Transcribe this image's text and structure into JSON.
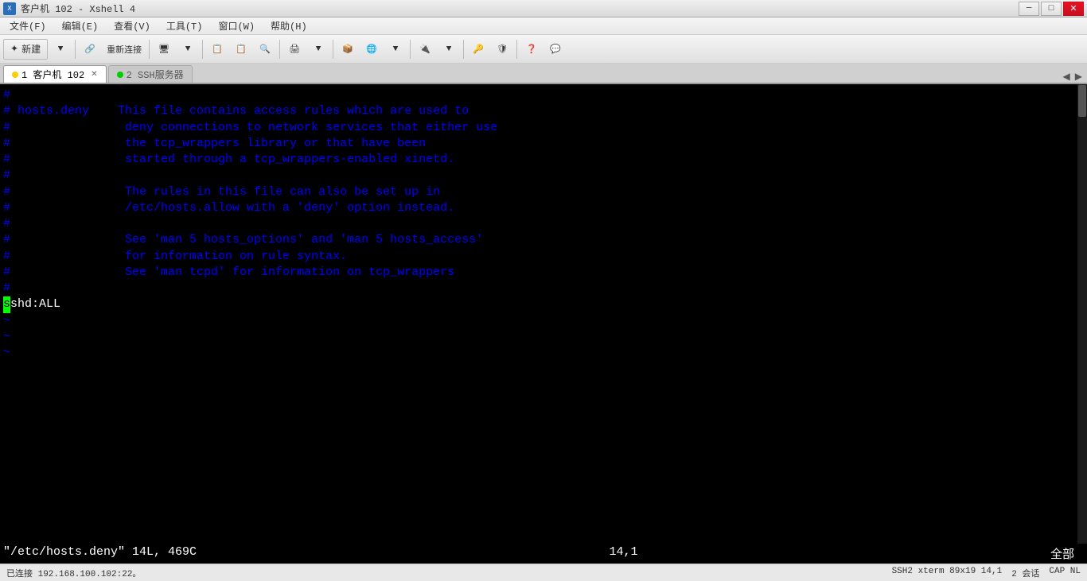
{
  "titlebar": {
    "title": "客户机 102 - Xshell 4",
    "icon": "X",
    "minimize": "─",
    "maximize": "□",
    "close": "✕"
  },
  "menubar": {
    "items": [
      "文件(F)",
      "编辑(E)",
      "查看(V)",
      "工具(T)",
      "窗口(W)",
      "帮助(H)"
    ]
  },
  "toolbar": {
    "new_label": "新建",
    "reconnect_label": "重新连接",
    "buttons": [
      "📁",
      "◀",
      "🔗",
      "🔄",
      "📋",
      "📋",
      "🔍",
      "🖨️",
      "◀",
      "📦",
      "🌐",
      "◀",
      "🔌",
      "◀",
      "🔑",
      "🛡️",
      "❓",
      "💬"
    ]
  },
  "tabs": [
    {
      "id": "tab1",
      "label": "1 客户机 102",
      "active": true,
      "dot_color": "#ffcc00"
    },
    {
      "id": "tab2",
      "label": "2 SSH服务器",
      "active": false,
      "dot_color": "#00cc00"
    }
  ],
  "terminal": {
    "lines": [
      {
        "type": "hash",
        "content": "#"
      },
      {
        "type": "hash",
        "content": "# hosts.deny    This file contains access rules which are used to"
      },
      {
        "type": "hash",
        "content": "#                deny connections to network services that either use"
      },
      {
        "type": "hash",
        "content": "#                the tcp_wrappers library or that have been"
      },
      {
        "type": "hash",
        "content": "#                started through a tcp_wrappers-enabled xinetd."
      },
      {
        "type": "hash",
        "content": "#"
      },
      {
        "type": "hash",
        "content": "#                The rules in this file can also be set up in"
      },
      {
        "type": "hash",
        "content": "#                /etc/hosts.allow with a 'deny' option instead."
      },
      {
        "type": "hash",
        "content": "#"
      },
      {
        "type": "hash",
        "content": "#                See 'man 5 hosts_options' and 'man 5 hosts_access'"
      },
      {
        "type": "hash",
        "content": "#                for information on rule syntax."
      },
      {
        "type": "hash",
        "content": "#                See 'man tcpd' for information on tcp_wrappers"
      },
      {
        "type": "hash",
        "content": "#"
      },
      {
        "type": "cursor",
        "content": "sshd:ALL"
      },
      {
        "type": "tilde",
        "content": "~"
      },
      {
        "type": "tilde",
        "content": "~"
      },
      {
        "type": "tilde",
        "content": "~"
      }
    ],
    "status_left": "\"/etc/hosts.deny\" 14L, 469C",
    "status_middle": "14,1",
    "status_right": "全部"
  },
  "statusbar": {
    "connection": "已连接 192.168.100.102:22。",
    "ssh_info": "SSH2  xterm  89x19  14,1",
    "sessions": "2 会话",
    "cap": "CAP  NL"
  }
}
